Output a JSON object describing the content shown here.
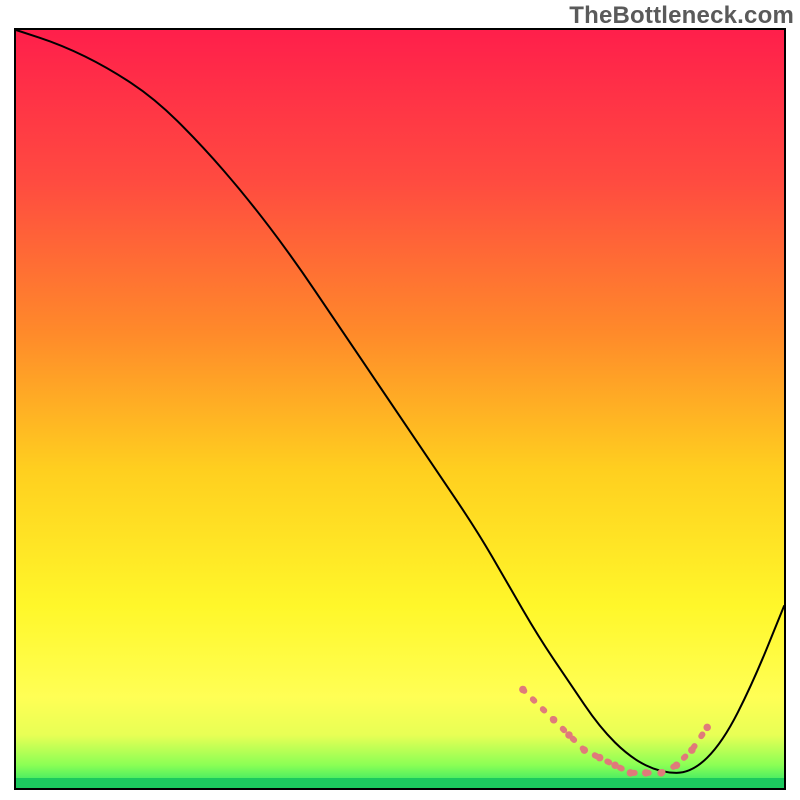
{
  "watermark": "TheBottleneck.com",
  "chart_data": {
    "type": "line",
    "title": "",
    "xlabel": "",
    "ylabel": "",
    "xlim": [
      0,
      100
    ],
    "ylim": [
      0,
      100
    ],
    "grid": false,
    "legend": false,
    "gradient_stops": [
      {
        "offset": 0,
        "color": "#ff1f4b"
      },
      {
        "offset": 20,
        "color": "#ff4b40"
      },
      {
        "offset": 40,
        "color": "#ff8a2a"
      },
      {
        "offset": 58,
        "color": "#ffcf1f"
      },
      {
        "offset": 76,
        "color": "#fff72a"
      },
      {
        "offset": 88,
        "color": "#ffff55"
      },
      {
        "offset": 93,
        "color": "#e8ff55"
      },
      {
        "offset": 97,
        "color": "#8aff55"
      },
      {
        "offset": 100,
        "color": "#22e26a"
      }
    ],
    "series": [
      {
        "name": "curve",
        "stroke": "#000000",
        "stroke_width": 2,
        "x": [
          0,
          6,
          12,
          18,
          24,
          30,
          36,
          42,
          48,
          54,
          60,
          64,
          68,
          72,
          76,
          80,
          84,
          88,
          92,
          96,
          100
        ],
        "y": [
          100,
          98,
          95,
          91,
          85,
          78,
          70,
          61,
          52,
          43,
          34,
          27,
          20,
          14,
          8,
          4,
          2,
          2,
          6,
          14,
          24
        ]
      },
      {
        "name": "valley-highlight",
        "stroke": "#e07a7a",
        "stroke_width": 6,
        "style": "dotted",
        "x": [
          66,
          70,
          72,
          74,
          76,
          78,
          80,
          82,
          84,
          86,
          88,
          90
        ],
        "y": [
          13,
          9,
          7,
          5,
          4,
          3,
          2,
          2,
          2,
          3,
          5,
          8
        ]
      }
    ]
  }
}
